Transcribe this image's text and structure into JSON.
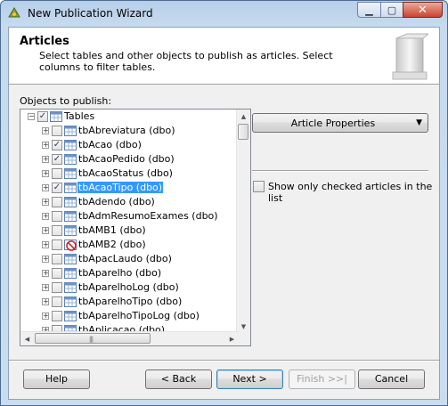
{
  "window": {
    "title": "New Publication Wizard"
  },
  "header": {
    "title": "Articles",
    "description": "Select tables and other objects to publish as articles. Select columns to filter tables."
  },
  "objects_label": "Objects to publish:",
  "tree": {
    "root": {
      "label": "Tables",
      "checked": true
    },
    "items": [
      {
        "label": "tbAbreviatura (dbo)",
        "checked": false
      },
      {
        "label": "tbAcao (dbo)",
        "checked": true
      },
      {
        "label": "tbAcaoPedido (dbo)",
        "checked": true
      },
      {
        "label": "tbAcaoStatus (dbo)",
        "checked": false
      },
      {
        "label": "tbAcaoTipo (dbo)",
        "checked": true,
        "selected": true
      },
      {
        "label": "tbAdendo (dbo)",
        "checked": false
      },
      {
        "label": "tbAdmResumoExames (dbo)",
        "checked": false
      },
      {
        "label": "tbAMB1 (dbo)",
        "checked": false
      },
      {
        "label": "tbAMB2 (dbo)",
        "checked": false,
        "blocked": true
      },
      {
        "label": "tbApacLaudo (dbo)",
        "checked": false
      },
      {
        "label": "tbAparelho (dbo)",
        "checked": false
      },
      {
        "label": "tbAparelhoLog (dbo)",
        "checked": false
      },
      {
        "label": "tbAparelhoTipo (dbo)",
        "checked": false
      },
      {
        "label": "tbAparelhoTipoLog (dbo)",
        "checked": false
      },
      {
        "label": "tbAplicacao (dbo)",
        "checked": false
      }
    ]
  },
  "article_properties": {
    "label": "Article Properties"
  },
  "show_only_checked": {
    "label": "Show only checked articles in the list",
    "checked": false
  },
  "buttons": {
    "help": "Help",
    "back": "< Back",
    "next": "Next >",
    "finish": "Finish >>|",
    "cancel": "Cancel"
  },
  "colors": {
    "selection": "#3399ff",
    "header_bg": "#ffffff",
    "client_bg": "#f0f0f0"
  }
}
